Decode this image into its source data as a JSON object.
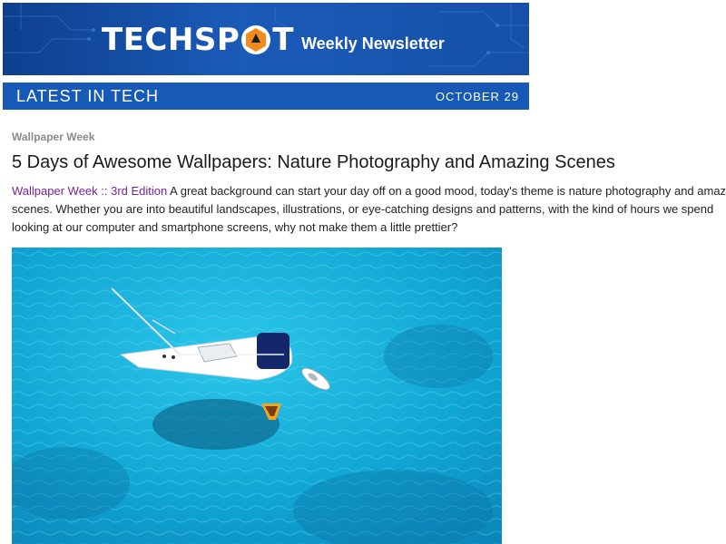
{
  "header": {
    "logo": {
      "before": "TECHSP",
      "after": "T"
    },
    "subtitle": "Weekly Newsletter"
  },
  "section_bar": {
    "label": "LATEST IN TECH",
    "date": "OCTOBER 29"
  },
  "article": {
    "category": "Wallpaper Week",
    "title": "5 Days of Awesome Wallpapers: Nature Photography and Amazing Scenes",
    "edition_link": "Wallpaper Week :: 3rd Edition",
    "body_line1": " A great background can start your day off on a good mood, today's theme is nature photography and amazing",
    "body_line2": "scenes. Whether you are into beautiful landscapes, illustrations, or eye-catching designs and patterns, with the kind of hours we spend",
    "body_line3": "looking at our computer and smartphone screens, why not make them a little prettier?"
  },
  "colors": {
    "header_blue": "#1a5bb8",
    "bar_blue": "#1659b7",
    "link_purple": "#7b1fa2",
    "sea": "#0fb0d8",
    "logo_orange": "#f28a1c"
  }
}
